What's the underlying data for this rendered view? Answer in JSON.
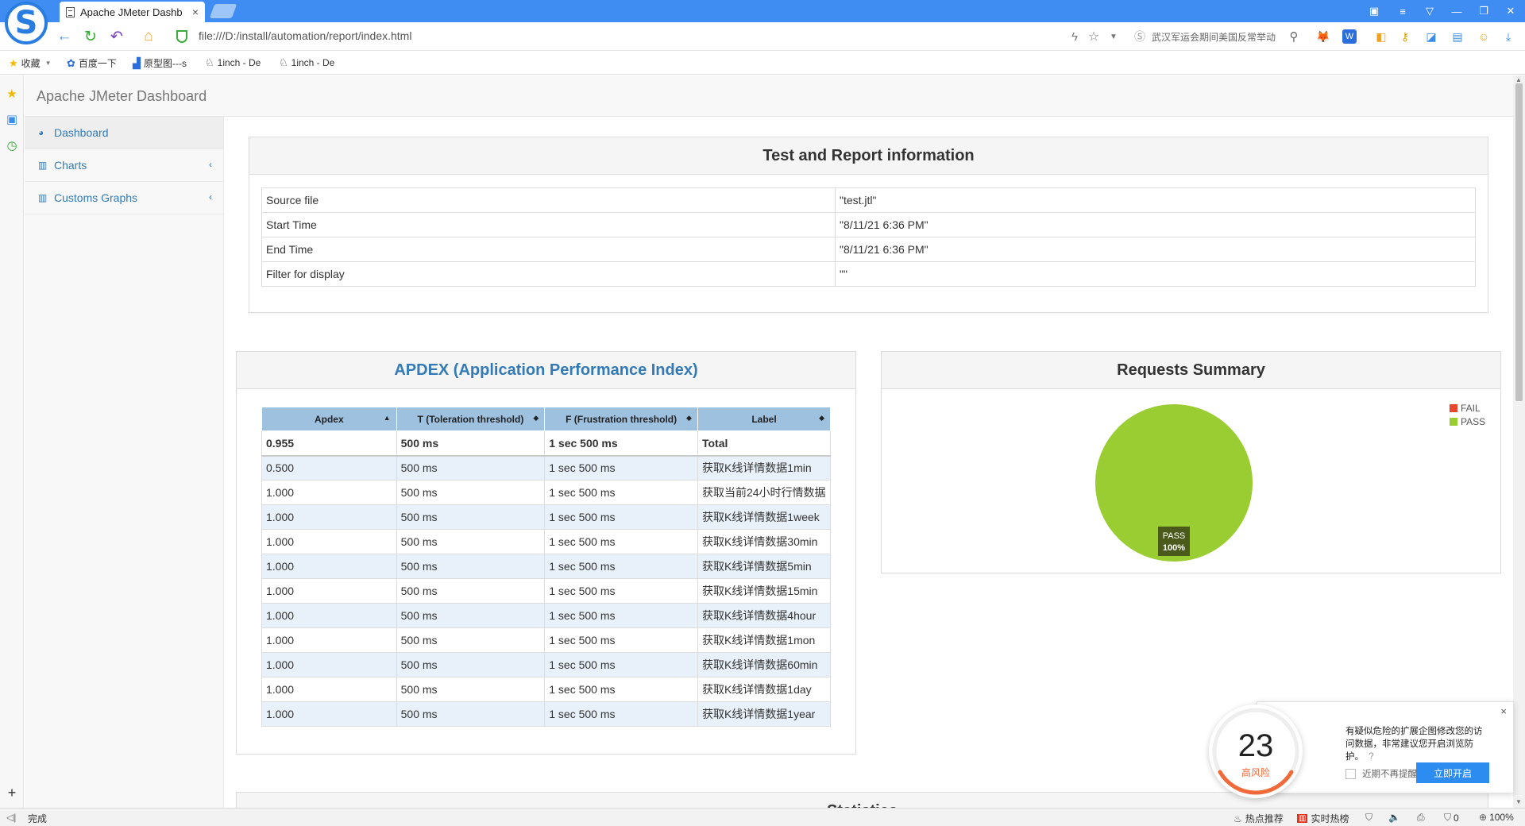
{
  "browser": {
    "tab_title": "Apache JMeter Dashb",
    "tab_close": "×",
    "url": "file:///D:/install/automation/report/index.html",
    "search_hint": "武汉军运会期间美国反常举动",
    "logo_letter": "S",
    "bookmarks": [
      {
        "icon": "star-icon",
        "label": "收藏"
      },
      {
        "icon": "paw-icon",
        "label": "百度一下"
      },
      {
        "icon": "prototype-icon",
        "label": "原型图---s"
      },
      {
        "icon": "unicorn-icon",
        "label": "1inch - De"
      },
      {
        "icon": "unicorn-icon",
        "label": "1inch - De"
      }
    ],
    "status": {
      "left": "完成",
      "hot_recommend": "热点推荐",
      "realtime_hot": "实时热榜",
      "download_count": "0",
      "zoom": "100%"
    }
  },
  "page": {
    "brand": "Apache JMeter Dashboard",
    "sidebar": {
      "items": [
        {
          "label": "Dashboard",
          "icon": "dashboard-icon",
          "active": true
        },
        {
          "label": "Charts",
          "icon": "bar-chart-icon",
          "chevron": "‹"
        },
        {
          "label": "Customs Graphs",
          "icon": "bar-chart-icon",
          "chevron": "‹"
        }
      ]
    },
    "test_report": {
      "title": "Test and Report information",
      "rows": [
        {
          "key": "Source file",
          "value": "\"test.jtl\""
        },
        {
          "key": "Start Time",
          "value": "\"8/11/21 6:36 PM\""
        },
        {
          "key": "End Time",
          "value": "\"8/11/21 6:36 PM\""
        },
        {
          "key": "Filter for display",
          "value": "\"\""
        }
      ]
    },
    "apdex": {
      "title": "APDEX (Application Performance Index)",
      "headers": [
        "Apdex",
        "T (Toleration threshold)",
        "F (Frustration threshold)",
        "Label"
      ],
      "sort_icons": [
        "▲",
        "◆",
        "◆",
        "◆"
      ],
      "total": {
        "apdex": "0.955",
        "t": "500 ms",
        "f": "1 sec 500 ms",
        "label": "Total"
      },
      "rows": [
        {
          "apdex": "0.500",
          "t": "500 ms",
          "f": "1 sec 500 ms",
          "label": "获取K线详情数据1min"
        },
        {
          "apdex": "1.000",
          "t": "500 ms",
          "f": "1 sec 500 ms",
          "label": "获取当前24小时行情数据"
        },
        {
          "apdex": "1.000",
          "t": "500 ms",
          "f": "1 sec 500 ms",
          "label": "获取K线详情数据1week"
        },
        {
          "apdex": "1.000",
          "t": "500 ms",
          "f": "1 sec 500 ms",
          "label": "获取K线详情数据30min"
        },
        {
          "apdex": "1.000",
          "t": "500 ms",
          "f": "1 sec 500 ms",
          "label": "获取K线详情数据5min"
        },
        {
          "apdex": "1.000",
          "t": "500 ms",
          "f": "1 sec 500 ms",
          "label": "获取K线详情数据15min"
        },
        {
          "apdex": "1.000",
          "t": "500 ms",
          "f": "1 sec 500 ms",
          "label": "获取K线详情数据4hour"
        },
        {
          "apdex": "1.000",
          "t": "500 ms",
          "f": "1 sec 500 ms",
          "label": "获取K线详情数据1mon"
        },
        {
          "apdex": "1.000",
          "t": "500 ms",
          "f": "1 sec 500 ms",
          "label": "获取K线详情数据60min"
        },
        {
          "apdex": "1.000",
          "t": "500 ms",
          "f": "1 sec 500 ms",
          "label": "获取K线详情数据1day"
        },
        {
          "apdex": "1.000",
          "t": "500 ms",
          "f": "1 sec 500 ms",
          "label": "获取K线详情数据1year"
        }
      ]
    },
    "requests_summary": {
      "title": "Requests Summary"
    },
    "statistics_title": "Statistics"
  },
  "chart_data": {
    "type": "pie",
    "title": "Requests Summary",
    "categories": [
      "FAIL",
      "PASS"
    ],
    "values": [
      0,
      100
    ],
    "colors": {
      "FAIL": "#e8472e",
      "PASS": "#9acd32"
    },
    "data_labels": [
      {
        "name": "PASS",
        "value": "100%"
      }
    ],
    "legend": "top-right"
  },
  "risk_popup": {
    "score": "23",
    "level": "高风险",
    "message": "有疑似危险的扩展企图修改您的访问数据，非常建议您开启浏览防护。",
    "help_icon": "?",
    "dont_remind": "近期不再提醒",
    "enable_button": "立即开启",
    "close": "×"
  },
  "colors": {
    "titlebar": "#3f8df2",
    "link": "#337ab7",
    "apdex_header": "#9ec1e0",
    "apdex_row_alt": "#e8f1f9",
    "pass": "#9acd32",
    "fail": "#e8472e"
  }
}
